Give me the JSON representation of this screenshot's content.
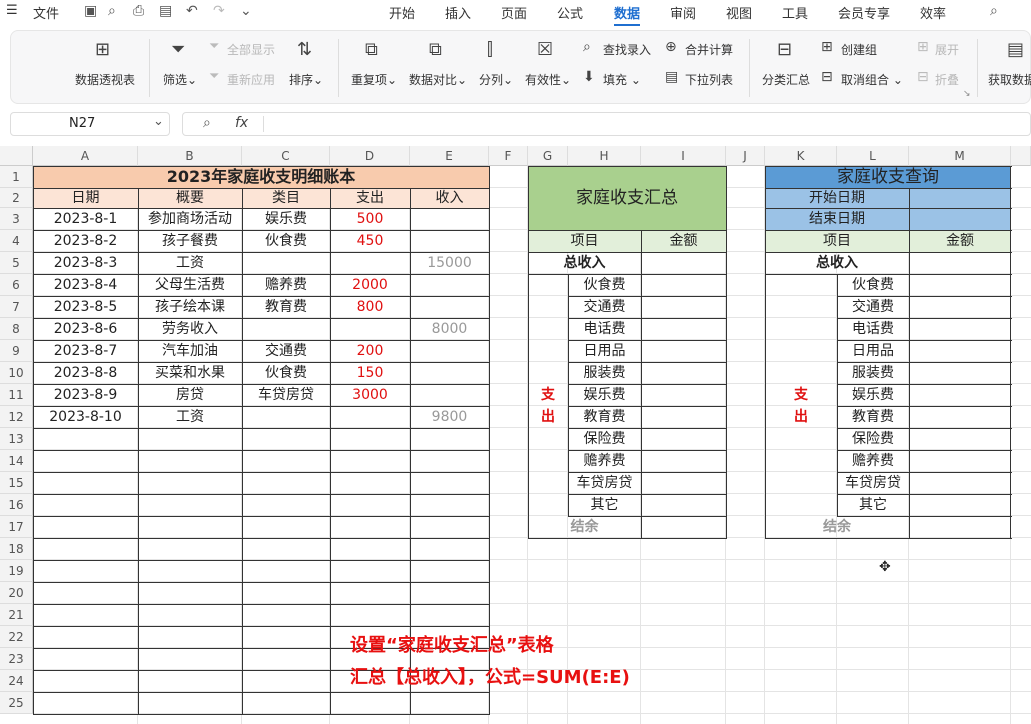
{
  "menubar": {
    "file": "文件",
    "tabs": [
      "开始",
      "插入",
      "页面",
      "公式",
      "数据",
      "审阅",
      "视图",
      "工具",
      "会员专享",
      "效率"
    ],
    "active_tab": "数据"
  },
  "ribbon": {
    "pivot": "数据透视表",
    "filter": "筛选",
    "show_all": "全部显示",
    "reapply": "重新应用",
    "sort": "排序",
    "duplicates": "重复项",
    "compare": "数据对比",
    "split": "分列",
    "validity": "有效性",
    "find_entry": "查找录入",
    "fill": "填充",
    "merge_calc": "合并计算",
    "dropdown_list": "下拉列表",
    "subtotal": "分类汇总",
    "create_group": "创建组",
    "ungroup": "取消组合",
    "expand": "展开",
    "collapse": "折叠",
    "get_data": "获取数据"
  },
  "formula_bar": {
    "name_box": "N27",
    "fx": "fx",
    "formula": ""
  },
  "columns": [
    "A",
    "B",
    "C",
    "D",
    "E",
    "F",
    "G",
    "H",
    "I",
    "J",
    "K",
    "L",
    "M"
  ],
  "rows": [
    "1",
    "2",
    "3",
    "4",
    "5",
    "6",
    "7",
    "8",
    "9",
    "10",
    "11",
    "12",
    "13",
    "14",
    "15",
    "16",
    "17",
    "18",
    "19",
    "20",
    "21",
    "22",
    "23",
    "24",
    "25"
  ],
  "ledger": {
    "title": "2023年家庭收支明细账本",
    "headers": [
      "日期",
      "概要",
      "类目",
      "支出",
      "收入"
    ],
    "records": [
      [
        "2023-8-1",
        "参加商场活动",
        "娱乐费",
        "500",
        ""
      ],
      [
        "2023-8-2",
        "孩子餐费",
        "伙食费",
        "450",
        ""
      ],
      [
        "2023-8-3",
        "工资",
        "",
        "",
        "15000"
      ],
      [
        "2023-8-4",
        "父母生活费",
        "赡养费",
        "2000",
        ""
      ],
      [
        "2023-8-5",
        "孩子绘本课",
        "教育费",
        "800",
        ""
      ],
      [
        "2023-8-6",
        "劳务收入",
        "",
        "",
        "8000"
      ],
      [
        "2023-8-7",
        "汽车加油",
        "交通费",
        "200",
        ""
      ],
      [
        "2023-8-8",
        "买菜和水果",
        "伙食费",
        "150",
        ""
      ],
      [
        "2023-8-9",
        "房贷",
        "车贷房贷",
        "3000",
        ""
      ],
      [
        "2023-8-10",
        "工资",
        "",
        "",
        "9800"
      ]
    ]
  },
  "summary": {
    "title": "家庭收支汇总",
    "col_item": "项目",
    "col_amount": "金额",
    "total_income": "总收入",
    "expense_label": [
      "支",
      "出"
    ],
    "categories": [
      "伙食费",
      "交通费",
      "电话费",
      "日用品",
      "服装费",
      "娱乐费",
      "教育费",
      "保险费",
      "赡养费",
      "车贷房贷",
      "其它"
    ],
    "balance": "结余"
  },
  "query": {
    "title": "家庭收支查询",
    "start_date": "开始日期",
    "end_date": "结束日期",
    "col_item": "项目",
    "col_amount": "金额",
    "total_income": "总收入",
    "expense_label": [
      "支",
      "出"
    ],
    "categories": [
      "伙食费",
      "交通费",
      "电话费",
      "日用品",
      "服装费",
      "娱乐费",
      "教育费",
      "保险费",
      "赡养费",
      "车贷房贷",
      "其它"
    ],
    "balance": "结余"
  },
  "annotation": {
    "line1": "设置“家庭收支汇总”表格",
    "line2": "汇总【总收入】，公式=SUM(E:E)"
  },
  "colors": {
    "accent": "#1f6fd0",
    "ledger_title_bg": "#f8cbad",
    "ledger_header_bg": "#fce4d6",
    "summary_title_bg": "#a9d08e",
    "summary_header_bg": "#e2efda",
    "query_title_bg": "#5b9bd5",
    "query_date_bg": "#9bc2e6",
    "expense_red": "#e01010",
    "income_gray": "#999999"
  }
}
